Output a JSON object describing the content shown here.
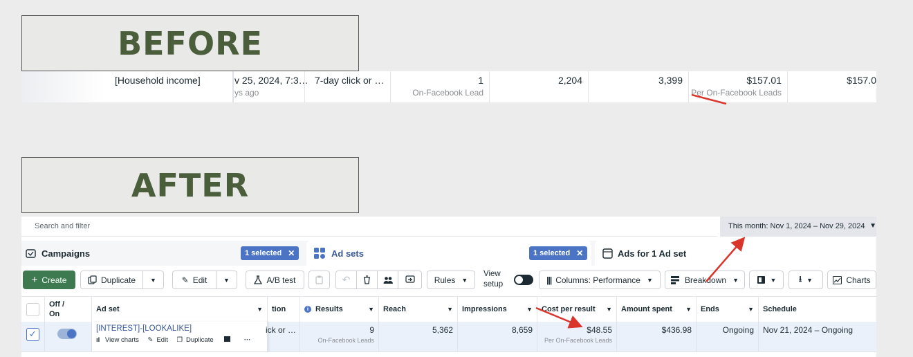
{
  "labels": {
    "before": "BEFORE",
    "after": "AFTER"
  },
  "before_row": {
    "adset_name": "[Household income]",
    "last_edit": "v 25, 2024, 7:3…",
    "last_edit_sub": "ys ago",
    "attribution": "7-day click or …",
    "results": "1",
    "results_sub": "On-Facebook Lead",
    "reach": "2,204",
    "impressions": "3,399",
    "cost_per_result": "$157.01",
    "cost_sub": "Per On-Facebook Leads",
    "amount_spent": "$157.0"
  },
  "after": {
    "search_placeholder": "Search and filter",
    "date_range": "This month: Nov 1, 2024 – Nov 29, 2024",
    "tabs": {
      "campaigns": "Campaigns",
      "campaigns_chip": "1 selected",
      "adsets": "Ad sets",
      "adsets_chip": "1 selected",
      "ads": "Ads for 1 Ad set"
    },
    "toolbar": {
      "create": "Create",
      "duplicate": "Duplicate",
      "edit": "Edit",
      "ab_test": "A/B test",
      "rules": "Rules",
      "view_setup": "View setup",
      "columns": "Columns: Performance",
      "breakdown": "Breakdown",
      "charts": "Charts"
    },
    "headers": {
      "offon": "Off / On",
      "adset": "Ad set",
      "attribution": "tion",
      "results": "Results",
      "reach": "Reach",
      "impressions": "Impressions",
      "cost_per_result": "Cost per result",
      "amount_spent": "Amount spent",
      "ends": "Ends",
      "schedule": "Schedule"
    },
    "row": {
      "adset_name": "[INTEREST]-[LOOKALIKE]",
      "actions": {
        "view_charts": "View charts",
        "edit": "Edit",
        "duplicate": "Duplicate"
      },
      "attribution": "ick or …",
      "results": "9",
      "results_sub": "On-Facebook Leads",
      "reach": "5,362",
      "impressions": "8,659",
      "cost_per_result": "$48.55",
      "cost_sub": "Per On-Facebook Leads",
      "amount_spent": "$436.98",
      "ends": "Ongoing",
      "schedule": "Nov 21, 2024 – Ongoing"
    }
  },
  "colors": {
    "label_text": "#4a5e3b",
    "accent_blue": "#4b74c5",
    "arrow_red": "#d9352b",
    "create_green": "#3d7a4f"
  },
  "icons": [
    "campaigns-icon",
    "adsets-grid-icon",
    "ads-icon",
    "plus-icon",
    "duplicate-icon",
    "pencil-icon",
    "flask-icon",
    "clipboard-icon",
    "undo-icon",
    "trash-icon",
    "people-icon",
    "share-icon",
    "columns-icon",
    "breakdown-icon",
    "reports-icon",
    "download-icon",
    "chart-icon",
    "info-icon"
  ]
}
